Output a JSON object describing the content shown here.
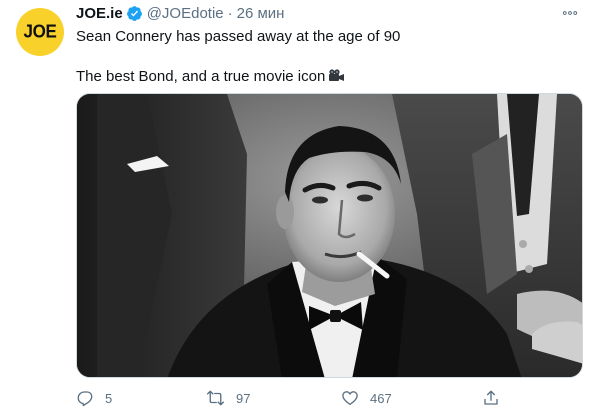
{
  "tweet": {
    "avatar_text": "JOE",
    "name": "JOE.ie",
    "handle": "@JOEdotie",
    "separator": "·",
    "time": "26 мин",
    "line1": "Sean Connery has passed away at the age of 90",
    "line2": "The best Bond, and a true movie icon",
    "icons": {
      "verified": "verified-badge-icon",
      "more": "more-options-icon",
      "emoji": "movie-camera-icon"
    },
    "image": {
      "description_name": "tweet-photo"
    }
  },
  "actions": {
    "reply_count": "5",
    "retweet_count": "97",
    "like_count": "467",
    "share_label": ""
  },
  "colors": {
    "accent": "#1da1f2",
    "muted": "#5b7083",
    "avatar_bg": "#f9d12b"
  }
}
